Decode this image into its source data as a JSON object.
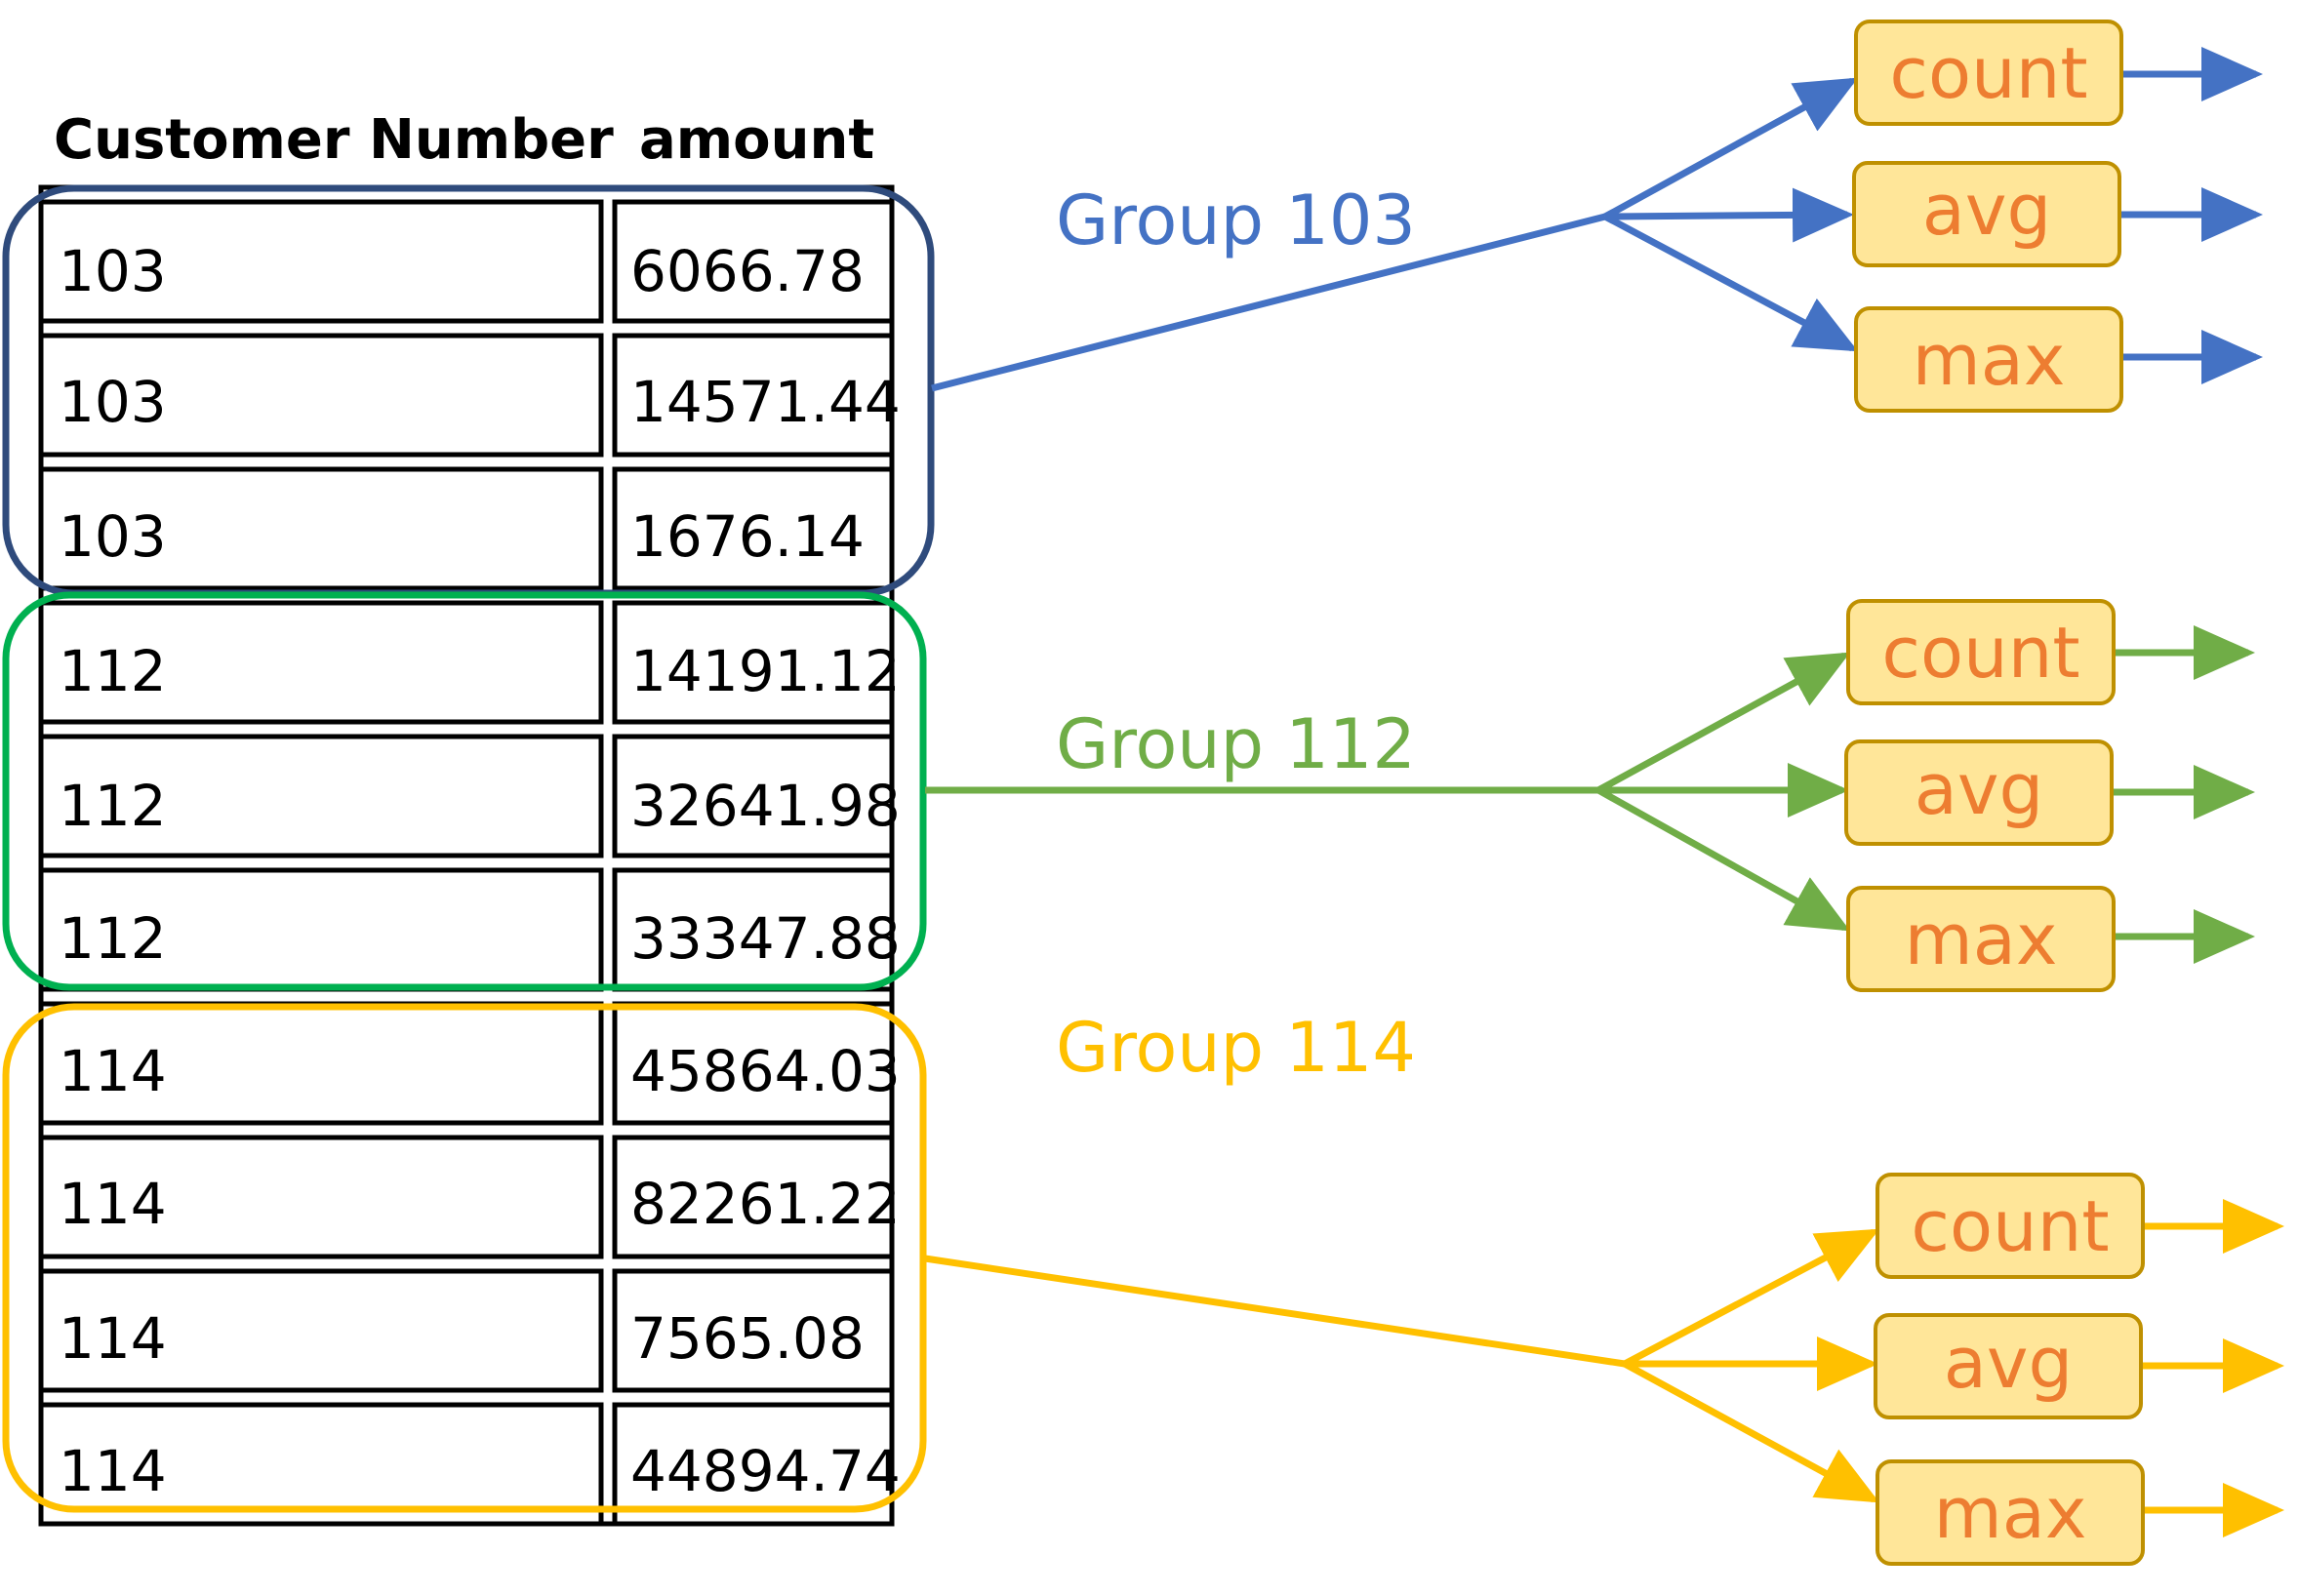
{
  "table": {
    "headers": [
      "Customer Number",
      "amount"
    ],
    "rows": [
      [
        "103",
        "6066.78"
      ],
      [
        "103",
        "14571.44"
      ],
      [
        "103",
        "1676.14"
      ],
      [
        "112",
        "14191.12"
      ],
      [
        "112",
        "32641.98"
      ],
      [
        "112",
        "33347.88"
      ],
      [
        "114",
        "45864.03"
      ],
      [
        "114",
        "82261.22"
      ],
      [
        "114",
        "7565.08"
      ],
      [
        "114",
        "44894.74"
      ]
    ]
  },
  "groups": [
    {
      "label": "Group 103",
      "color": "#4472C4",
      "outline_color": "#2F4B7C",
      "aggregates": [
        "count",
        "avg",
        "max"
      ]
    },
    {
      "label": "Group 112",
      "color": "#70AD47",
      "outline_color": "#00B050",
      "aggregates": [
        "count",
        "avg",
        "max"
      ]
    },
    {
      "label": "Group 114",
      "color": "#FFC000",
      "outline_color": "#FFC000",
      "aggregates": [
        "count",
        "avg",
        "max"
      ]
    }
  ],
  "aggregate_style": {
    "fill": "#FFE699",
    "stroke": "#BF9000",
    "text_color": "#ED7D31"
  }
}
